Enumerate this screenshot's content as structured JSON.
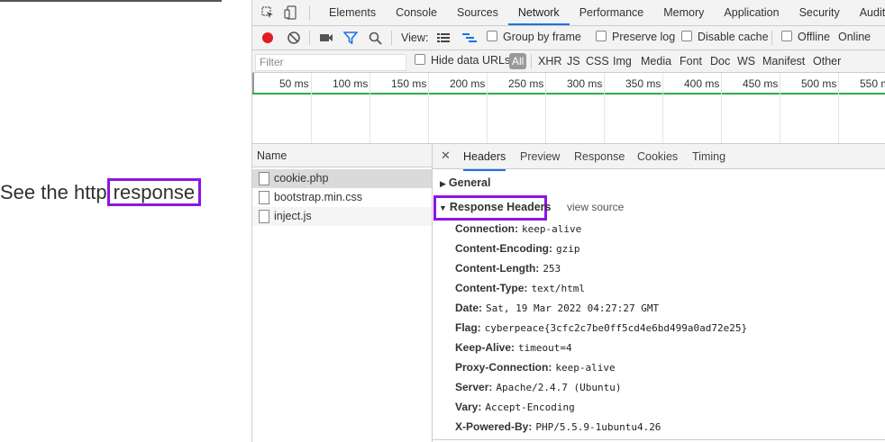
{
  "page": {
    "text_prefix": "See the http",
    "text_highlight": "response"
  },
  "devtools": {
    "tabs": [
      "Elements",
      "Console",
      "Sources",
      "Network",
      "Performance",
      "Memory",
      "Application",
      "Security",
      "Audits"
    ],
    "selected_tab": "Network",
    "toolbar": {
      "view_label": "View:",
      "group_by_frame": "Group by frame",
      "preserve_log": "Preserve log",
      "disable_cache": "Disable cache",
      "offline": "Offline",
      "online": "Online"
    },
    "filter_bar": {
      "filter_placeholder": "Filter",
      "hide_data_urls": "Hide data URLs",
      "types": [
        "All",
        "XHR",
        "JS",
        "CSS",
        "Img",
        "Media",
        "Font",
        "Doc",
        "WS",
        "Manifest",
        "Other"
      ]
    },
    "timeline_ticks": [
      "50 ms",
      "100 ms",
      "150 ms",
      "200 ms",
      "250 ms",
      "300 ms",
      "350 ms",
      "400 ms",
      "450 ms",
      "500 ms",
      "550 m"
    ],
    "name_column": {
      "header": "Name",
      "files": [
        "cookie.php",
        "bootstrap.min.css",
        "inject.js"
      ]
    },
    "detail_tabs": [
      "Headers",
      "Preview",
      "Response",
      "Cookies",
      "Timing"
    ],
    "general_label": "General",
    "response_headers_label": "Response Headers",
    "view_source_label": "view source",
    "headers": [
      {
        "key": "Connection:",
        "value": "keep-alive"
      },
      {
        "key": "Content-Encoding:",
        "value": "gzip"
      },
      {
        "key": "Content-Length:",
        "value": "253"
      },
      {
        "key": "Content-Type:",
        "value": "text/html"
      },
      {
        "key": "Date:",
        "value": "Sat, 19 Mar 2022 04:27:27 GMT"
      },
      {
        "key": "Flag:",
        "value": "cyberpeace{3cfc2c7be0ff5cd4e6bd499a0ad72e25}"
      },
      {
        "key": "Keep-Alive:",
        "value": "timeout=4"
      },
      {
        "key": "Proxy-Connection:",
        "value": "keep-alive"
      },
      {
        "key": "Server:",
        "value": "Apache/2.4.7 (Ubuntu)"
      },
      {
        "key": "Vary:",
        "value": "Accept-Encoding"
      },
      {
        "key": "X-Powered-By:",
        "value": "PHP/5.5.9-1ubuntu4.26"
      }
    ]
  }
}
